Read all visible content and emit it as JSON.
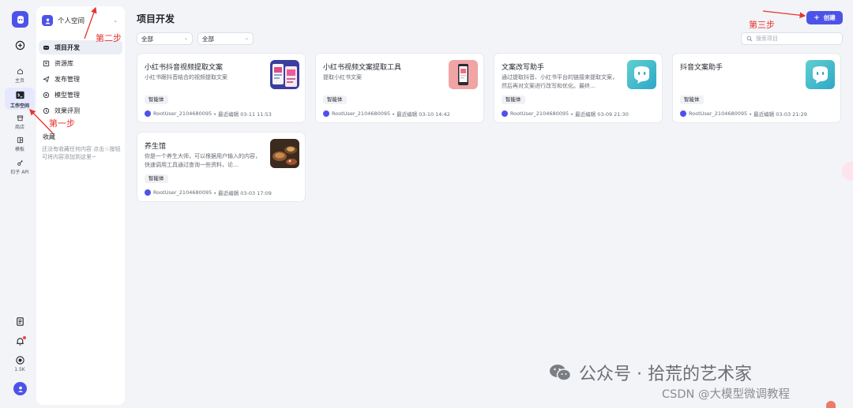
{
  "rail": {
    "items": [
      {
        "icon": "plus-circle-icon",
        "label": ""
      },
      {
        "icon": "home-icon",
        "label": "主页"
      },
      {
        "icon": "terminal-icon",
        "label": "工作空间"
      },
      {
        "icon": "store-icon",
        "label": "商店"
      },
      {
        "icon": "template-icon",
        "label": "模板"
      },
      {
        "icon": "plugin-icon",
        "label": "扣子 API"
      }
    ],
    "bottom_items": [
      {
        "icon": "document-icon"
      },
      {
        "icon": "bell-icon"
      },
      {
        "icon": "target-icon",
        "label": "1.5K"
      }
    ]
  },
  "subnav": {
    "space_label": "个人空间",
    "items": [
      {
        "label": "项目开发",
        "icon": "bot-icon"
      },
      {
        "label": "资源库",
        "icon": "library-icon"
      },
      {
        "label": "发布管理",
        "icon": "send-icon"
      },
      {
        "label": "模型管理",
        "icon": "model-icon"
      },
      {
        "label": "效果评测",
        "icon": "evaluation-icon"
      }
    ],
    "favorites_title": "收藏",
    "favorites_empty": "还没有收藏任何内容 点击☆按钮可将内容添加到这里~"
  },
  "main": {
    "title": "项目开发",
    "filters": [
      "全部",
      "全部"
    ],
    "create_label": "创建",
    "search_placeholder": "搜索项目"
  },
  "cards": [
    {
      "title": "小红书抖音视频提取文案",
      "desc": "小红书跟抖音结合的视频提取文案",
      "tag": "智能体",
      "owner": "RootUser_2104680095",
      "edited": "• 最近编辑 03-11 11:53",
      "thumb": "phones-image"
    },
    {
      "title": "小红书视频文案提取工具",
      "desc": "提取小红书文案",
      "tag": "智能体",
      "owner": "RootUser_2104680095",
      "edited": "• 最近编辑 03-10 14:42",
      "thumb": "phone-image"
    },
    {
      "title": "文案改写助手",
      "desc": "通过提取抖音、小红书平台的链接来提取文案，然后再对文案进行改写和优化。最终…",
      "tag": "智能体",
      "owner": "RootUser_2104680095",
      "edited": "• 最近编辑 03-09 21:30",
      "thumb": "bot-avatar-image"
    },
    {
      "title": "抖音文案助手",
      "desc": "",
      "tag": "智能体",
      "owner": "RootUser_2104680095",
      "edited": "• 最近编辑 03-03 21:29",
      "thumb": "bot-avatar-image"
    },
    {
      "title": "养生馆",
      "desc": "你是一个养生大师，可以根据用户输入的内容，快速调用工具通过查询一些资料，论…",
      "tag": "智能体",
      "owner": "RootUser_2104680095",
      "edited": "• 最近编辑 03-03 17:09",
      "thumb": "food-image"
    }
  ],
  "annotations": {
    "step1": "第一步",
    "step2": "第二步",
    "step3": "第三步"
  },
  "watermark": {
    "line1": "公众号 · 拾荒的艺术家",
    "line2": "CSDN @大模型微调教程"
  },
  "colors": {
    "accent": "#4d53e8",
    "annotation": "#e8322d"
  }
}
